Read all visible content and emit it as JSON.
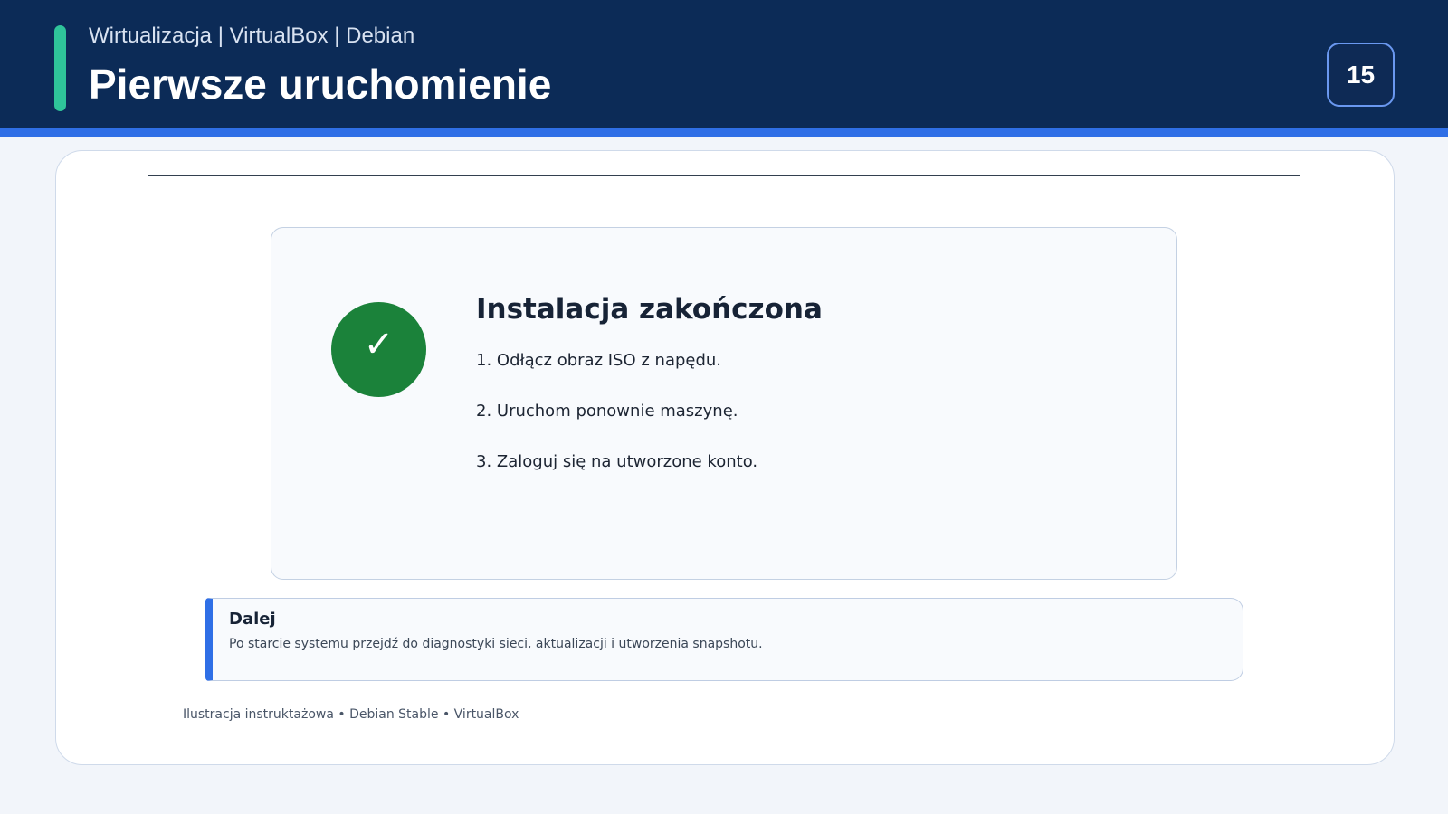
{
  "header": {
    "breadcrumb": "Wirtualizacja | VirtualBox | Debian",
    "title": "Pierwsze uruchomienie",
    "page_number": "15"
  },
  "colors": {
    "header_background": "#0c2b57",
    "accent_teal": "#2fc49a",
    "accent_blue": "#2f6fe6",
    "success_green": "#1b823a"
  },
  "dialog": {
    "status_icon": "checkmark-icon",
    "status_glyph": "✓",
    "title": "Instalacja zakończona",
    "steps": [
      "1. Odłącz obraz ISO z napędu.",
      "2. Uruchom ponownie maszynę.",
      "3. Zaloguj się na utworzone konto."
    ]
  },
  "note": {
    "title": "Dalej",
    "text": "Po starcie systemu przejdź do diagnostyki sieci, aktualizacji i utworzenia snapshotu."
  },
  "footer": {
    "caption": "Ilustracja instruktażowa • Debian Stable • VirtualBox"
  }
}
